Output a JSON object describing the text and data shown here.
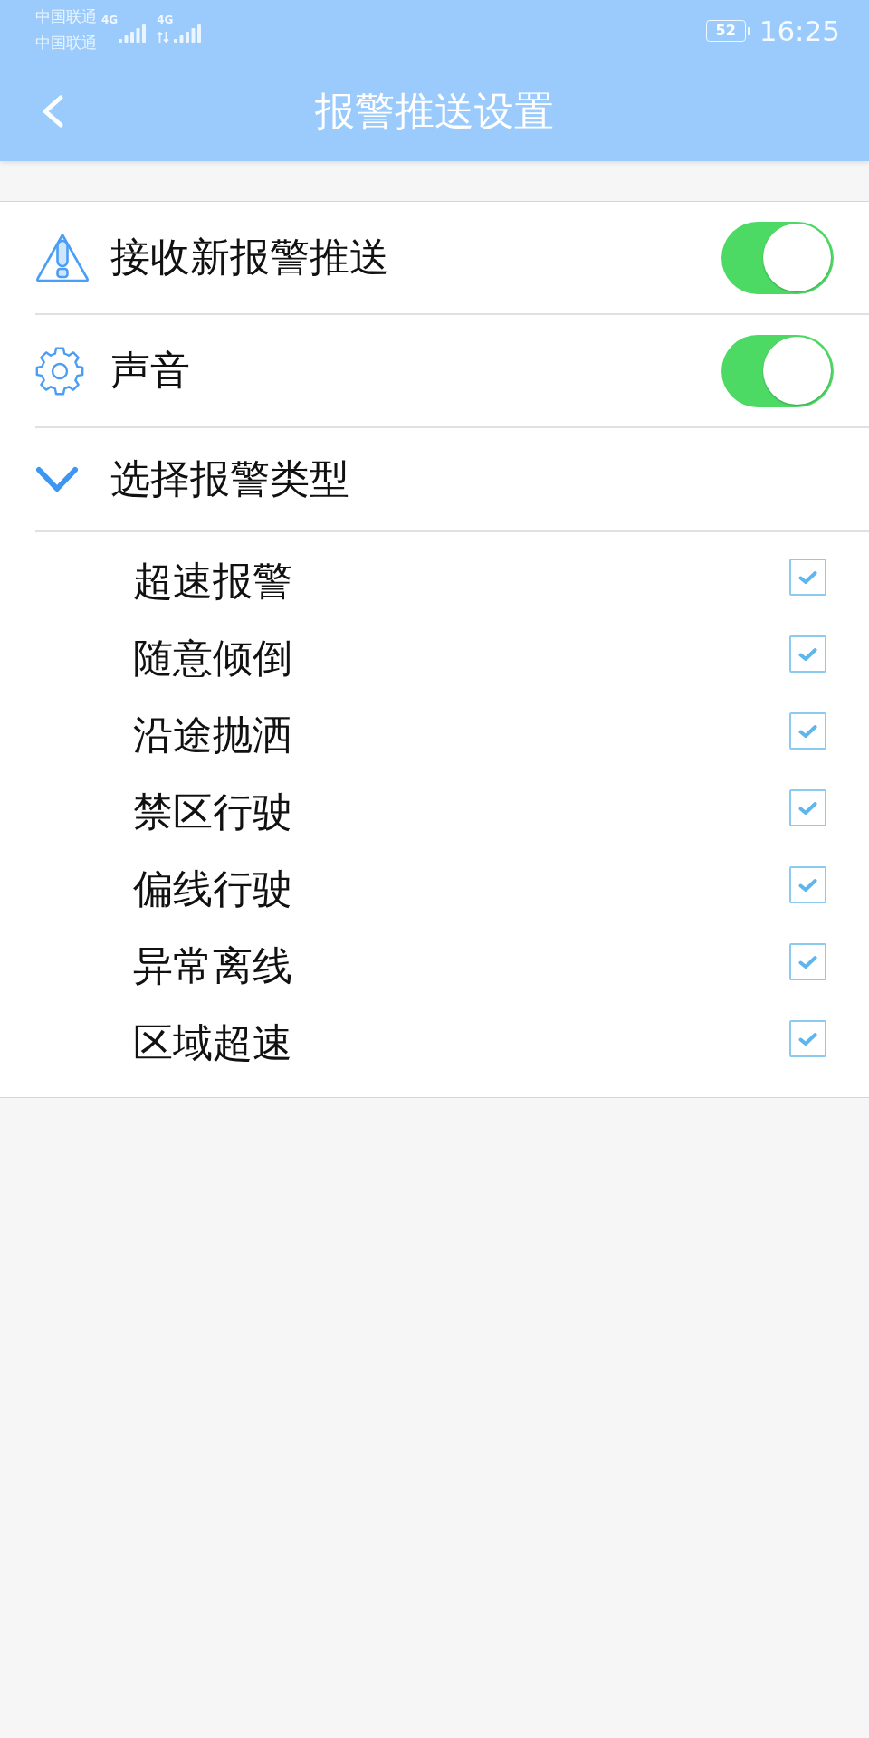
{
  "status_bar": {
    "carriers": [
      "中国联通",
      "中国联通"
    ],
    "networks": [
      {
        "label": "4G",
        "data_active": false
      },
      {
        "label": "4G",
        "data_active": true
      }
    ],
    "battery": "52",
    "time": "16:25"
  },
  "header": {
    "title": "报警推送设置"
  },
  "settings": [
    {
      "kind": "toggle",
      "label": "接收新报警推送",
      "on": true
    },
    {
      "kind": "toggle",
      "label": "声音",
      "on": true
    },
    {
      "kind": "expander",
      "label": "选择报警类型",
      "expanded": true
    }
  ],
  "alarm_types": [
    {
      "label": "超速报警",
      "checked": true
    },
    {
      "label": "随意倾倒",
      "checked": true
    },
    {
      "label": "沿途抛洒",
      "checked": true
    },
    {
      "label": "禁区行驶",
      "checked": true
    },
    {
      "label": "偏线行驶",
      "checked": true
    },
    {
      "label": "异常离线",
      "checked": true
    },
    {
      "label": "区域超速",
      "checked": true
    }
  ]
}
